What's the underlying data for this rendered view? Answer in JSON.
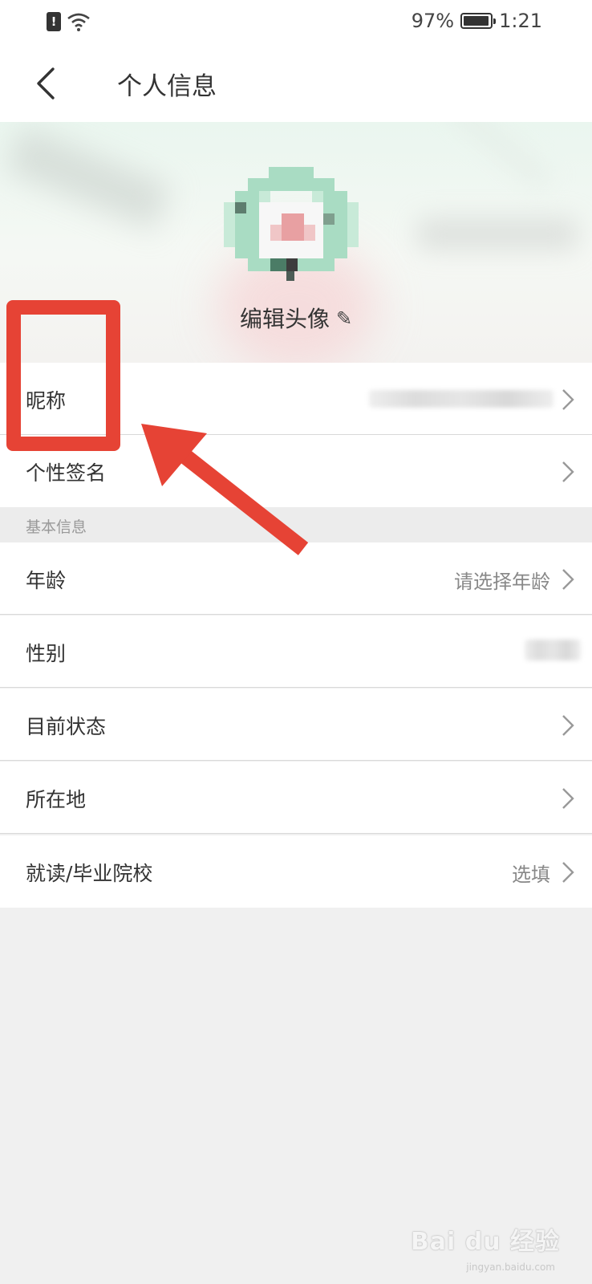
{
  "status_bar": {
    "battery": "97%",
    "battery_level": 0.97,
    "time": "1:21",
    "alert_glyph": "!"
  },
  "nav": {
    "title": "个人信息",
    "back_icon": "chevron-left-icon"
  },
  "header": {
    "edit_avatar": "编辑头像",
    "pencil": "✎"
  },
  "rows": [
    {
      "label": "昵称",
      "value": ""
    },
    {
      "label": "个性签名",
      "value": ""
    }
  ],
  "section": {
    "title": "基本信息"
  },
  "basic_rows": [
    {
      "label": "年龄",
      "value": "请选择年龄"
    },
    {
      "label": "性别",
      "value": ""
    },
    {
      "label": "目前状态",
      "value": ""
    },
    {
      "label": "所在地",
      "value": ""
    },
    {
      "label": "就读/毕业院校",
      "value": "选填"
    }
  ],
  "watermark": {
    "brand": "Bai du 经验",
    "sub": "jingyan.baidu.com"
  },
  "colors": {
    "annotation": "#e64335",
    "divider": "#d9d9d9",
    "muted_text": "#888888"
  }
}
